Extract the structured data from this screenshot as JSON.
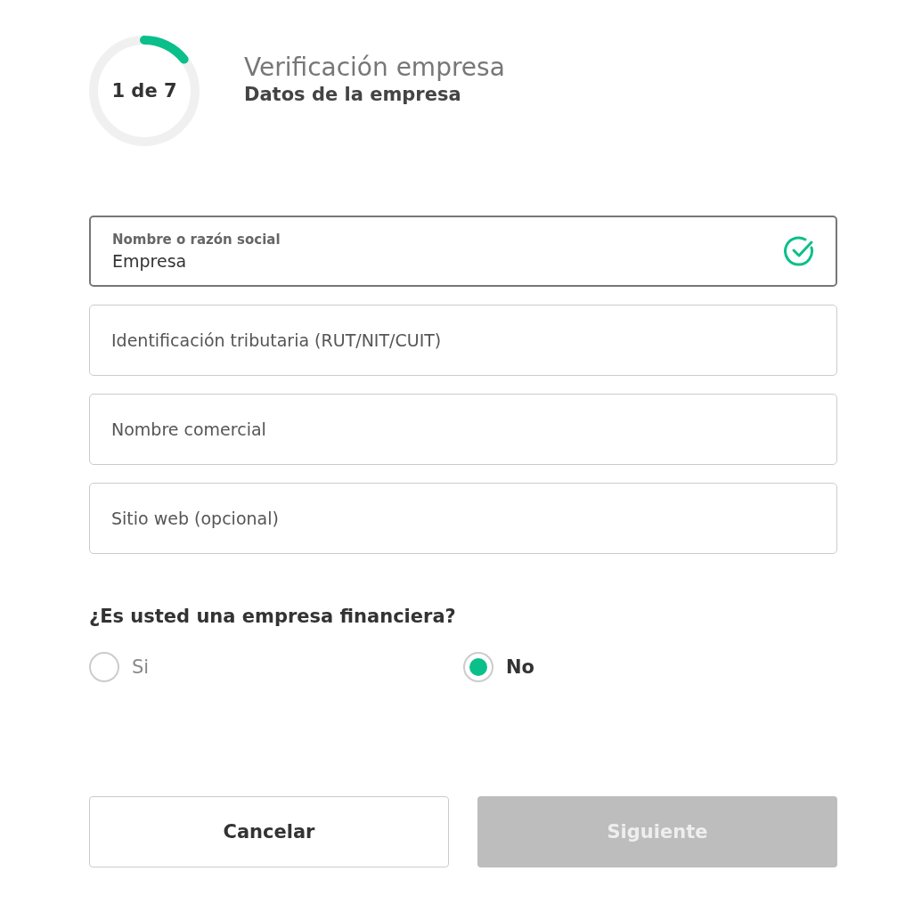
{
  "progress": {
    "label": "1 de 7",
    "level": 0.143
  },
  "header": {
    "title": "Verificación empresa",
    "subtitle": "Datos de la empresa"
  },
  "fields": [
    {
      "label": "Nombre o razón social",
      "value": "Empresa",
      "valid": true,
      "focused": true
    },
    {
      "placeholder": "Identificación tributaria (RUT/NIT/CUIT)",
      "valid": false,
      "focused": false
    },
    {
      "placeholder": "Nombre comercial",
      "valid": false,
      "focused": false
    },
    {
      "placeholder": "Sitio web (opcional)",
      "valid": false,
      "focused": false
    }
  ],
  "question": {
    "text": "¿Es usted una empresa financiera?",
    "options": [
      {
        "label": "Si",
        "selected": false
      },
      {
        "label": "No",
        "selected": true
      }
    ]
  },
  "buttons": [
    {
      "label": "Cancelar",
      "disabled": false
    },
    {
      "label": "Siguiente",
      "disabled": true
    }
  ]
}
